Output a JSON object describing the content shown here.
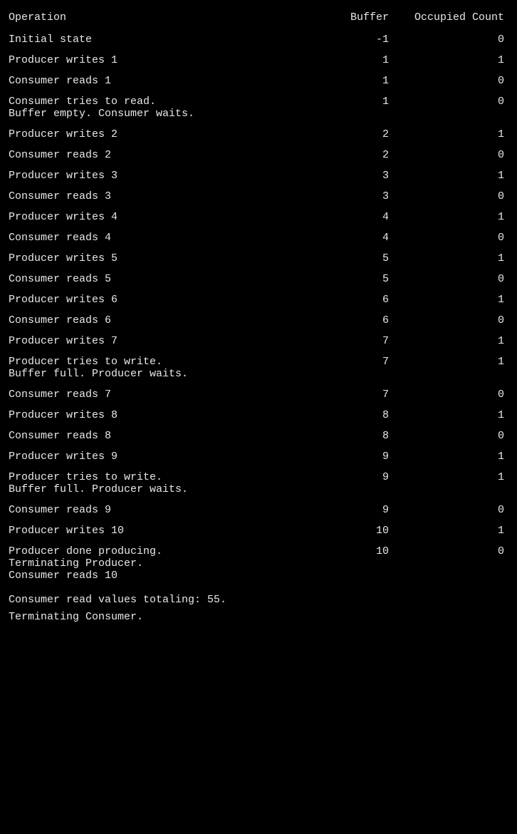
{
  "header": {
    "col_operation": "Operation",
    "col_buffer": "Buffer",
    "col_occupied": "Occupied Count"
  },
  "rows": [
    {
      "operation": "Initial state",
      "buffer": "-1",
      "occupied": "0"
    },
    {
      "operation": "Producer writes 1",
      "buffer": "1",
      "occupied": "1"
    },
    {
      "operation": "Consumer reads 1",
      "buffer": "1",
      "occupied": "0"
    },
    {
      "operation": "Consumer tries to read.\nBuffer empty. Consumer waits.",
      "buffer": "1",
      "occupied": "0"
    },
    {
      "operation": "Producer writes 2",
      "buffer": "2",
      "occupied": "1"
    },
    {
      "operation": "Consumer reads 2",
      "buffer": "2",
      "occupied": "0"
    },
    {
      "operation": "Producer writes 3",
      "buffer": "3",
      "occupied": "1"
    },
    {
      "operation": "Consumer reads 3",
      "buffer": "3",
      "occupied": "0"
    },
    {
      "operation": "Producer writes 4",
      "buffer": "4",
      "occupied": "1"
    },
    {
      "operation": "Consumer reads 4",
      "buffer": "4",
      "occupied": "0"
    },
    {
      "operation": "Producer writes 5",
      "buffer": "5",
      "occupied": "1"
    },
    {
      "operation": "Consumer reads 5",
      "buffer": "5",
      "occupied": "0"
    },
    {
      "operation": "Producer writes 6",
      "buffer": "6",
      "occupied": "1"
    },
    {
      "operation": "Consumer reads 6",
      "buffer": "6",
      "occupied": "0"
    },
    {
      "operation": "Producer writes 7",
      "buffer": "7",
      "occupied": "1"
    },
    {
      "operation": "Producer tries to write.\nBuffer full. Producer waits.",
      "buffer": "7",
      "occupied": "1"
    },
    {
      "operation": "Consumer reads 7",
      "buffer": "7",
      "occupied": "0"
    },
    {
      "operation": "Producer writes 8",
      "buffer": "8",
      "occupied": "1"
    },
    {
      "operation": "Consumer reads 8",
      "buffer": "8",
      "occupied": "0"
    },
    {
      "operation": "Producer writes 9",
      "buffer": "9",
      "occupied": "1"
    },
    {
      "operation": "Producer tries to write.\nBuffer full. Producer waits.",
      "buffer": "9",
      "occupied": "1"
    },
    {
      "operation": "Consumer reads 9",
      "buffer": "9",
      "occupied": "0"
    },
    {
      "operation": "Producer writes 10",
      "buffer": "10",
      "occupied": "1"
    },
    {
      "operation": "Producer done producing.\nTerminating Producer.\nConsumer reads 10",
      "buffer": "10",
      "occupied": "0"
    }
  ],
  "footer": "Consumer read values totaling: 55.\nTerminating Consumer."
}
